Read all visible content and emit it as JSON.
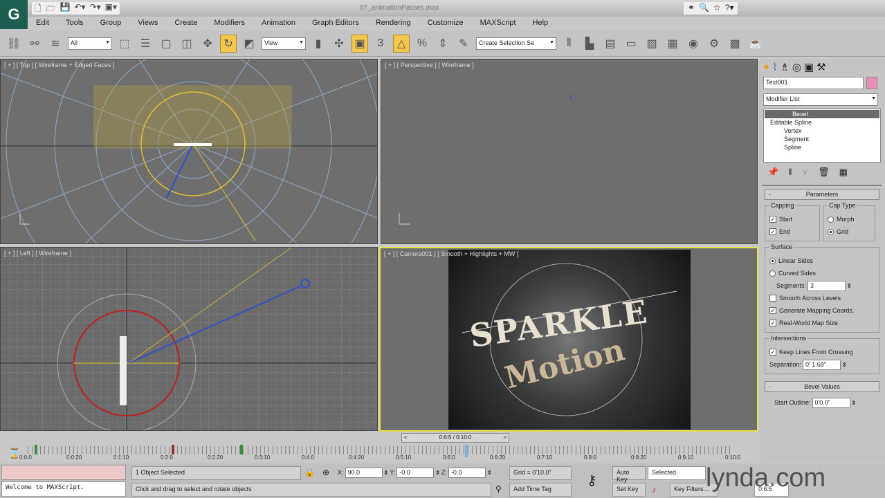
{
  "title_bar": {
    "filename": "07_animationPasses.max",
    "quick_access_icons": [
      "new-icon",
      "open-icon",
      "save-icon",
      "undo-icon",
      "redo-icon",
      "project-icon"
    ],
    "right_icons": [
      "binoculars-icon",
      "search-icon",
      "star-icon",
      "help-icon"
    ]
  },
  "app_logo": "3ds Max",
  "menu": [
    "Edit",
    "Tools",
    "Group",
    "Views",
    "Create",
    "Modifiers",
    "Animation",
    "Graph Editors",
    "Rendering",
    "Customize",
    "MAXScript",
    "Help"
  ],
  "toolbar": {
    "selection_filter": "All",
    "reference_coord": "View",
    "named_selection_placeholder": "Create Selection Se",
    "snap_label": "3"
  },
  "viewports": [
    {
      "id": "top",
      "label": "[ + ] [ Top ] [ Wireframe + Edged Faces ]"
    },
    {
      "id": "perspective",
      "label": "[ + ] [ Perspective ] [ Wireframe ]"
    },
    {
      "id": "left",
      "label": "[ + ] [ Left ] [ Wireframe ]"
    },
    {
      "id": "camera",
      "label": "[ + ] [ Camera001 ] [ Smooth + Highlights + MW ]",
      "render_text": [
        "SPARKLE",
        "Motion"
      ]
    }
  ],
  "command_panel": {
    "object_name": "Text001",
    "object_color": "#e890b8",
    "modifier_list": "Modifier List",
    "stack": [
      "Bevel",
      "Editable Spline",
      "Vertex",
      "Segment",
      "Spline"
    ],
    "parameters": {
      "title": "Parameters",
      "capping": {
        "title": "Capping",
        "start": "Start",
        "end": "End"
      },
      "cap_type": {
        "title": "Cap Type",
        "morph": "Morph",
        "grid": "Grid"
      },
      "surface": {
        "title": "Surface",
        "linear": "Linear Sides",
        "curved": "Curved Sides",
        "segments_label": "Segments:",
        "segments": "3",
        "smooth": "Smooth Across Levels",
        "gen_mapping": "Generate Mapping Coords.",
        "real_world": "Real-World Map Size"
      },
      "intersections": {
        "title": "Intersections",
        "keep_lines": "Keep Lines From Crossing",
        "separation_label": "Separation:",
        "separation": "0' 1.68\""
      }
    },
    "bevel_values": {
      "title": "Bevel Values",
      "start_outline_label": "Start Outline:",
      "start_outline": "0'0.0\""
    }
  },
  "timeline": {
    "slider": "0:6:5 / 0:10:0",
    "ticks": [
      "0:0:0",
      "0:0:20",
      "0:1:10",
      "0:2:0",
      "0:2:20",
      "0:3:10",
      "0:4:0",
      "0:4:20",
      "0:5:10",
      "0:6:0",
      "0:6:20",
      "0:7:10",
      "0:8:0",
      "0:8:20",
      "0:9:10",
      "0:10:0"
    ],
    "current_fraction": 0.62
  },
  "status": {
    "maxscript_output": "Welcome to MAXScript.",
    "selection": "1 Object Selected",
    "prompt": "Click and drag to select and rotate objects",
    "x": "90.0",
    "y": "-0.0",
    "z": "-0.0",
    "grid": "Grid = 0'10.0\"",
    "add_time_tag": "Add Time Tag",
    "auto_key": "Auto Key",
    "set_key": "Set Key",
    "key_mode": "Selected",
    "key_filters": "Key Filters...",
    "frame": "0:6:5"
  },
  "watermark": "lynda.com"
}
